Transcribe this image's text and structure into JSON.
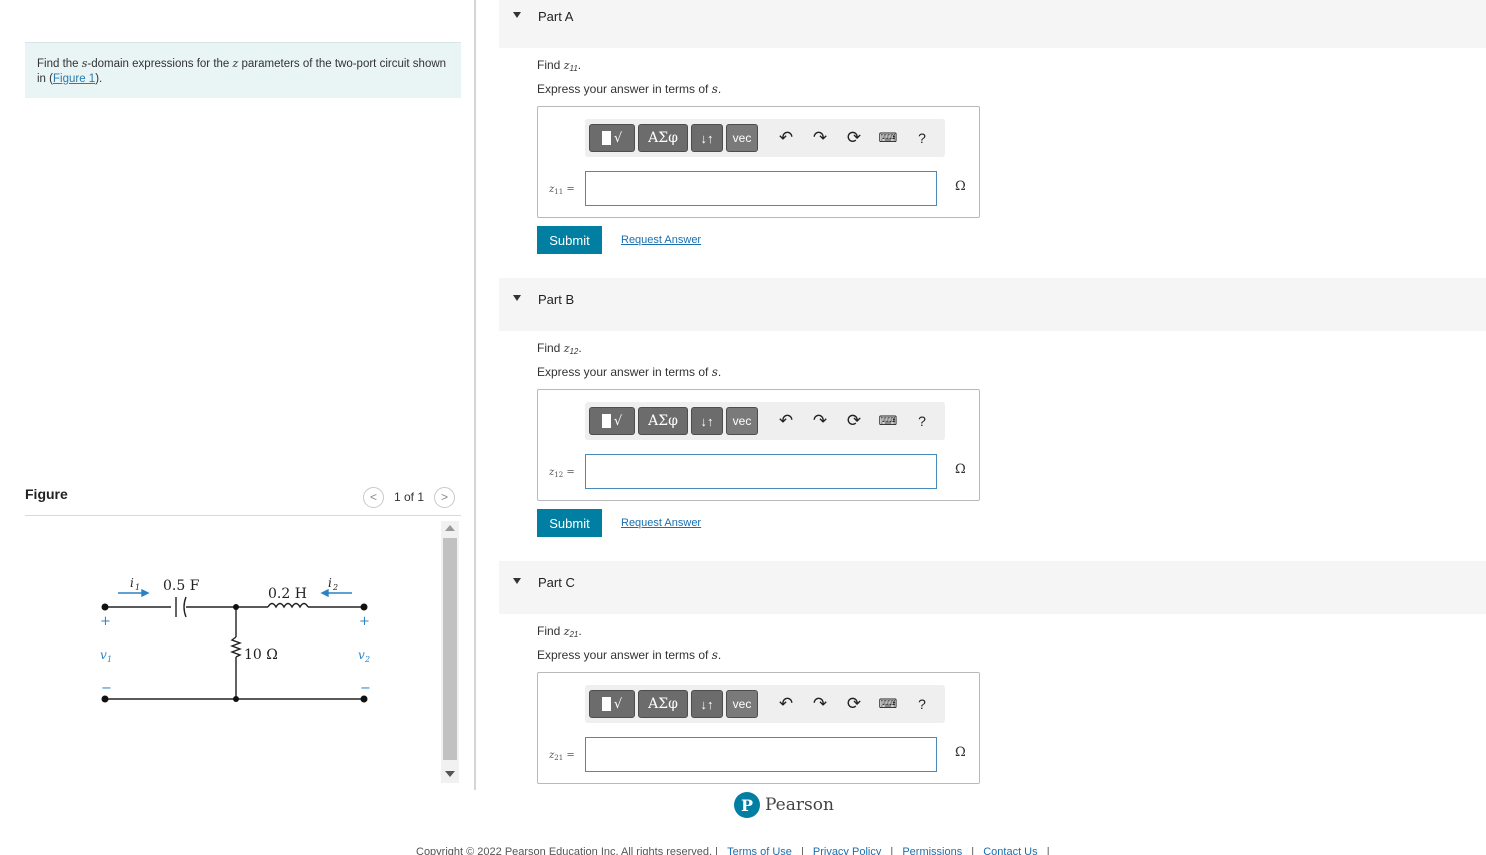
{
  "problem": {
    "text_prefix": "Find the ",
    "var_s": "s",
    "text_middle": "-domain expressions for the ",
    "var_z": "z",
    "text_suffix": " parameters of the two-port circuit shown in ",
    "open_paren": "(",
    "figure_link": "Figure 1",
    "close_paren": ")."
  },
  "figure": {
    "label": "Figure",
    "pager_prev": "<",
    "pager_count": "1 of 1",
    "pager_next": ">",
    "circuit": {
      "i1": "i",
      "i1_sub": "1",
      "i2": "i",
      "i2_sub": "2",
      "cap": "0.5 F",
      "ind": "0.2 H",
      "res": "10 Ω",
      "v1": "v",
      "v1_sub": "1",
      "v2": "v",
      "v2_sub": "2",
      "plus": "+",
      "minus": "−"
    }
  },
  "toolbar": {
    "templates_label": "√",
    "greek_label": "ΑΣφ",
    "arrows_label": "↓↑",
    "vec_label": "vec",
    "undo_icon": "undo-icon",
    "redo_icon": "redo-icon",
    "reset_icon": "reset-icon",
    "keyboard_icon": "keyboard-icon",
    "help_label": "?"
  },
  "parts": [
    {
      "title": "Part A",
      "find_prefix": "Find ",
      "var": "z",
      "sub": "11",
      "find_suffix": ".",
      "express_prefix": "Express your answer in terms of ",
      "express_var": "s",
      "express_suffix": ".",
      "label_sub": "11",
      "equals": " =",
      "input_value": "",
      "unit": "Ω",
      "submit": "Submit",
      "request": "Request Answer"
    },
    {
      "title": "Part B",
      "find_prefix": "Find ",
      "var": "z",
      "sub": "12",
      "find_suffix": ".",
      "express_prefix": "Express your answer in terms of ",
      "express_var": "s",
      "express_suffix": ".",
      "label_sub": "12",
      "equals": " =",
      "input_value": "",
      "unit": "Ω",
      "submit": "Submit",
      "request": "Request Answer"
    },
    {
      "title": "Part C",
      "find_prefix": "Find ",
      "var": "z",
      "sub": "21",
      "find_suffix": ".",
      "express_prefix": "Express your answer in terms of ",
      "express_var": "s",
      "express_suffix": ".",
      "label_sub": "21",
      "equals": " =",
      "input_value": "",
      "unit": "Ω"
    }
  ],
  "brand": {
    "logo_letter": "P",
    "name": "Pearson"
  },
  "footer": {
    "copyright": "Copyright © 2022 Pearson Education Inc. All rights reserved.",
    "sep": "|",
    "terms": "Terms of Use",
    "privacy": "Privacy Policy",
    "permissions": "Permissions",
    "contact": "Contact Us"
  },
  "colors": {
    "accent": "#007fa3",
    "problem_bg": "#e9f4f5",
    "link": "#1a6fb0",
    "input_border": "#4b8ab8"
  }
}
